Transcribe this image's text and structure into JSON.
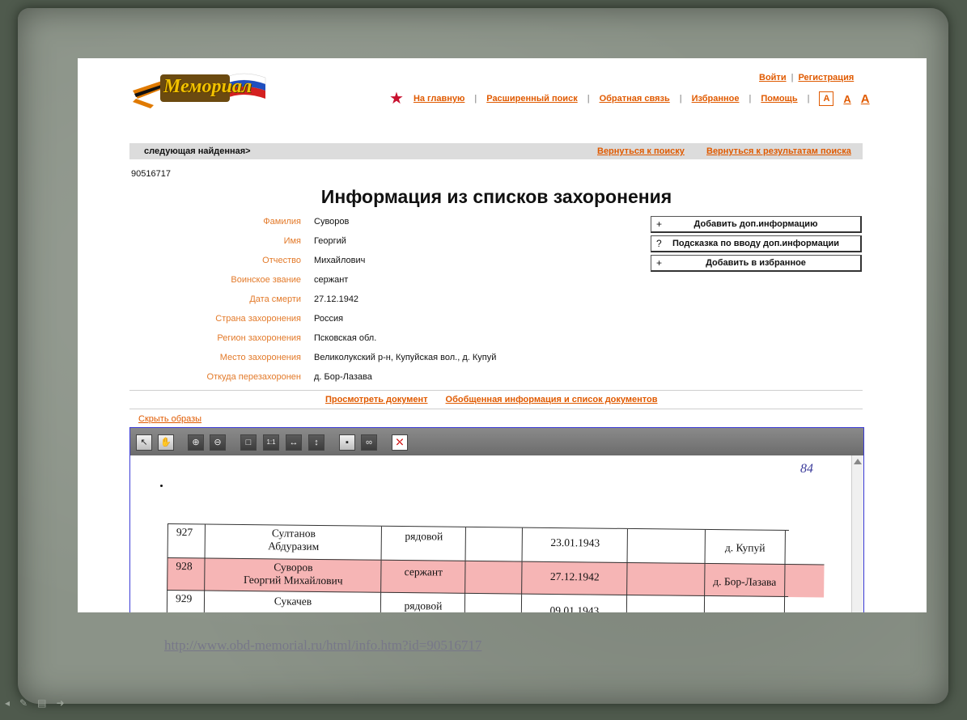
{
  "site": {
    "logo_text": "Мемориал",
    "auth": {
      "login": "Войти",
      "register": "Регистрация"
    },
    "nav": [
      "На главную",
      "Расширенный поиск",
      "Обратная связь",
      "Избранное",
      "Помощь"
    ],
    "font_sizes": [
      "А",
      "А",
      "А"
    ]
  },
  "record_bar": {
    "next_found": "следующая найденная>",
    "back_to_search": "Вернуться к поиску",
    "back_to_results": "Вернуться к результатам поиска"
  },
  "record_id": "90516717",
  "page_title": "Информация из списков захоронения",
  "fields": [
    {
      "label": "Фамилия",
      "value": "Суворов"
    },
    {
      "label": "Имя",
      "value": "Георгий"
    },
    {
      "label": "Отчество",
      "value": "Михайлович"
    },
    {
      "label": "Воинское звание",
      "value": "сержант"
    },
    {
      "label": "Дата смерти",
      "value": "27.12.1942"
    },
    {
      "label": "Страна захоронения",
      "value": "Россия"
    },
    {
      "label": "Регион захоронения",
      "value": "Псковская обл."
    },
    {
      "label": "Место захоронения",
      "value": "Великолукский р-н, Купуйская вол., д. Купуй"
    },
    {
      "label": "Откуда перезахоронен",
      "value": "д. Бор-Лазава"
    }
  ],
  "actions": [
    {
      "symbol": "+",
      "label": "Добавить доп.информацию"
    },
    {
      "symbol": "?",
      "label": "Подсказка по вводу доп.информации"
    },
    {
      "symbol": "+",
      "label": "Добавить в избранное"
    }
  ],
  "doc_links": {
    "view_document": "Просмотреть документ",
    "summary": "Обобщенная информация и список документов"
  },
  "hide_images": "Скрыть образы",
  "document": {
    "page_mark": "84",
    "rows": [
      {
        "num": "927",
        "name1": "Султанов",
        "name2": "Абдуразим",
        "rank": "рядовой",
        "date": "23.01.1943",
        "place": "д. Купуй",
        "highlight": false
      },
      {
        "num": "928",
        "name1": "Суворов",
        "name2": "Георгий Михайлович",
        "rank": "сержант",
        "date": "27.12.1942",
        "place": "д. Бор-Лазава",
        "highlight": true
      },
      {
        "num": "929",
        "name1": "Сукачев",
        "name2": "",
        "rank": "рядовой",
        "date": "09.01.1943",
        "place": "",
        "highlight": false
      }
    ]
  },
  "slide_url": "http://www.obd-memorial.ru/html/info.htm?id=90516717"
}
